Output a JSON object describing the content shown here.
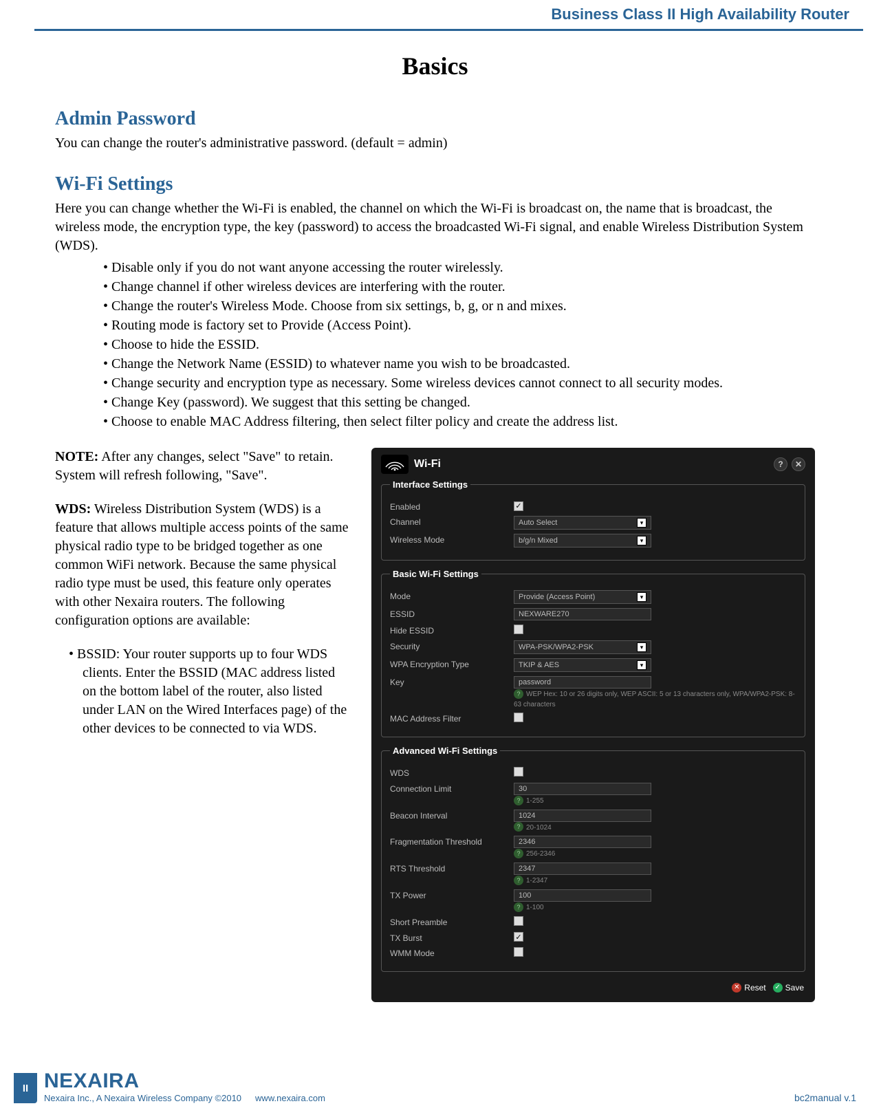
{
  "header": {
    "product_line": "Business Class II High Availability Router"
  },
  "page": {
    "title": "Basics",
    "admin": {
      "heading": "Admin Password",
      "text": "You can change the router's administrative password. (default = admin)"
    },
    "wifi": {
      "heading": "Wi-Fi Settings",
      "intro": "Here you can change whether the Wi-Fi is enabled, the channel on which the Wi-Fi is broadcast on, the name that is broadcast, the wireless mode, the encryption type, the key (password) to access the broadcasted Wi-Fi signal, and enable Wireless Distribution System (WDS).",
      "bullets": [
        "Disable only if you do not want anyone accessing the router wirelessly.",
        "Change channel if other wireless devices are interfering with the router.",
        "Change the router's Wireless Mode. Choose from six settings, b, g, or n and mixes.",
        "Routing mode is factory set to Provide (Access Point).",
        "Choose to hide the ESSID.",
        "Change the Network Name (ESSID) to whatever name you wish to be broadcasted.",
        "Change security and encryption type as necessary. Some wireless devices cannot connect to all security modes.",
        "Change Key (password). We suggest that this setting be changed.",
        "Choose to enable MAC Address filtering, then select filter policy and create the address list."
      ]
    },
    "note": {
      "label": "NOTE:",
      "text": " After any changes, select \"Save\" to retain. System will refresh following, \"Save\"."
    },
    "wds": {
      "label": "WDS:",
      "text": " Wireless Distribution System (WDS) is a feature that allows multiple access points of the same physical radio type to be bridged together as one common WiFi network. Because the same physical radio type must be used, this feature only operates with other Nexaira routers. The following configuration options are available:",
      "bssid": "• BSSID: Your router supports up to four WDS clients. Enter the BSSID (MAC address listed on the bottom label of the router, also listed under LAN on the Wired Interfaces page) of the other devices to be connected to via WDS."
    }
  },
  "panel": {
    "title": "Wi-Fi",
    "groups": {
      "interface": {
        "legend": "Interface Settings",
        "enabled_label": "Enabled",
        "enabled_checked": "✓",
        "channel_label": "Channel",
        "channel_value": "Auto Select",
        "wmode_label": "Wireless Mode",
        "wmode_value": "b/g/n Mixed"
      },
      "basic": {
        "legend": "Basic Wi-Fi Settings",
        "mode_label": "Mode",
        "mode_value": "Provide (Access Point)",
        "essid_label": "ESSID",
        "essid_value": "NEXWARE270",
        "hide_label": "Hide ESSID",
        "security_label": "Security",
        "security_value": "WPA-PSK/WPA2-PSK",
        "enc_label": "WPA Encryption Type",
        "enc_value": "TKIP & AES",
        "key_label": "Key",
        "key_value": "password",
        "key_help": "WEP Hex: 10 or 26 digits only, WEP ASCII: 5 or 13 characters only, WPA/WPA2-PSK: 8-63 characters",
        "mac_label": "MAC Address Filter"
      },
      "advanced": {
        "legend": "Advanced Wi-Fi Settings",
        "wds_label": "WDS",
        "conn_label": "Connection Limit",
        "conn_value": "30",
        "conn_range": "1-255",
        "beacon_label": "Beacon Interval",
        "beacon_value": "1024",
        "beacon_range": "20-1024",
        "frag_label": "Fragmentation Threshold",
        "frag_value": "2346",
        "frag_range": "256-2346",
        "rts_label": "RTS Threshold",
        "rts_value": "2347",
        "rts_range": "1-2347",
        "tx_label": "TX Power",
        "tx_value": "100",
        "tx_range": "1-100",
        "preamble_label": "Short Preamble",
        "burst_label": "TX Burst",
        "burst_checked": "✓",
        "wmm_label": "WMM Mode"
      }
    },
    "footer": {
      "reset": "Reset",
      "save": "Save"
    }
  },
  "footer": {
    "page_number": "II",
    "logo": "NEXAIRA",
    "company": "Nexaira Inc., A Nexaira Wireless Company ©2010",
    "url": "www.nexaira.com",
    "version": "bc2manual v.1"
  }
}
